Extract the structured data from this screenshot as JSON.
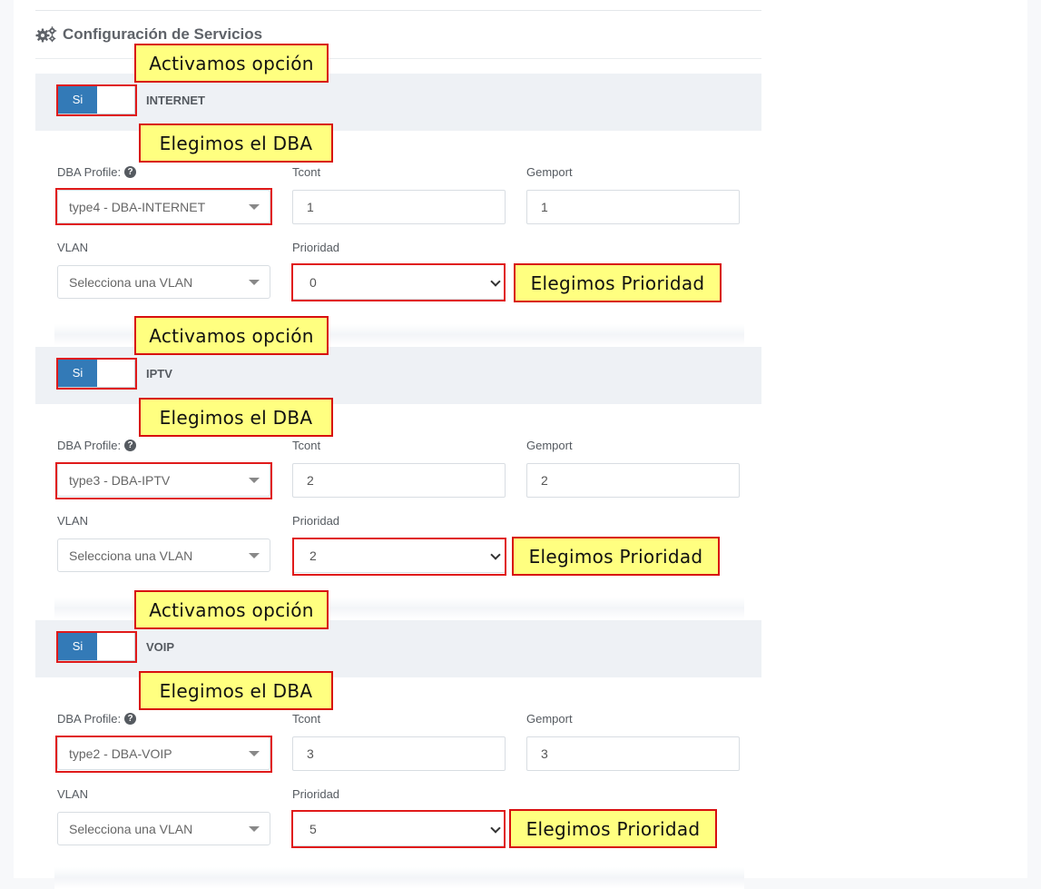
{
  "section": {
    "title": "Configuración de Servicios",
    "icon": "gears-icon"
  },
  "labels": {
    "dba_profile": "DBA Profile:",
    "tcont": "Tcont",
    "gemport": "Gemport",
    "vlan": "VLAN",
    "prioridad": "Prioridad",
    "help_glyph": "?"
  },
  "services": [
    {
      "name": "INTERNET",
      "toggle": "Si",
      "dba": "type4 - DBA-INTERNET",
      "tcont": "1",
      "gemport": "1",
      "vlan_placeholder": "Selecciona una VLAN",
      "prioridad": "0"
    },
    {
      "name": "IPTV",
      "toggle": "Si",
      "dba": "type3 - DBA-IPTV",
      "tcont": "2",
      "gemport": "2",
      "vlan_placeholder": "Selecciona una VLAN",
      "prioridad": "2"
    },
    {
      "name": "VOIP",
      "toggle": "Si",
      "dba": "type2 - DBA-VOIP",
      "tcont": "3",
      "gemport": "3",
      "vlan_placeholder": "Selecciona una VLAN",
      "prioridad": "5"
    }
  ],
  "annotations": {
    "activate": "Activamos opción",
    "choose_dba": "Elegimos el DBA",
    "choose_priority": "Elegimos Prioridad",
    "highlight_color": "#e01a1a",
    "callout_bg": "#ffff80"
  },
  "colors": {
    "toggle_on": "#337ab7",
    "header_bg": "#eef1f5"
  }
}
